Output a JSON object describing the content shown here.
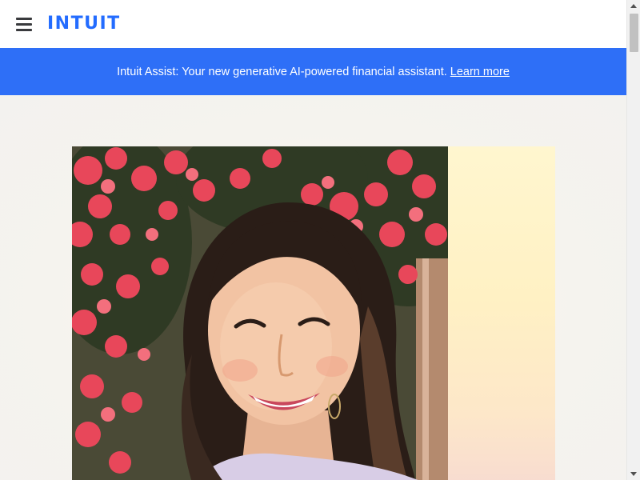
{
  "header": {
    "logo_text": "INTUIT",
    "menu_icon": "hamburger-menu-icon"
  },
  "banner": {
    "message": "Intuit Assist: Your new generative AI-powered financial assistant.",
    "link_label": "Learn more"
  },
  "hero": {
    "image_subject": "smiling woman with hoop earrings in front of pink bougainvillea"
  },
  "colors": {
    "brand_blue": "#236cff",
    "banner_blue": "#2e6ff7",
    "accent_yellow": "#fff1c4"
  }
}
